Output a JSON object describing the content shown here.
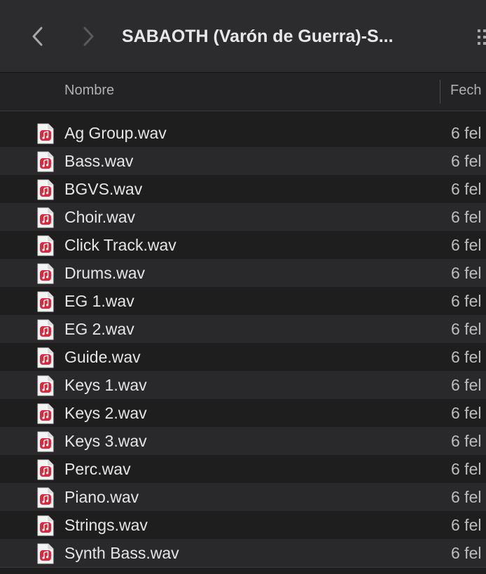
{
  "window": {
    "title": "SABAOTH (Varón de Guerra)-S..."
  },
  "toolbar": {
    "back_icon": "chevron-left-icon",
    "forward_icon": "chevron-right-icon",
    "view_icon": "grid-view-icon"
  },
  "columns": {
    "name": "Nombre",
    "date": "Fech"
  },
  "files": [
    {
      "name": "Ag Group.wav",
      "date": "6 fel"
    },
    {
      "name": "Bass.wav",
      "date": "6 fel"
    },
    {
      "name": "BGVS.wav",
      "date": "6 fel"
    },
    {
      "name": "Choir.wav",
      "date": "6 fel"
    },
    {
      "name": "Click Track.wav",
      "date": "6 fel"
    },
    {
      "name": "Drums.wav",
      "date": "6 fel"
    },
    {
      "name": "EG 1.wav",
      "date": "6 fel"
    },
    {
      "name": "EG 2.wav",
      "date": "6 fel"
    },
    {
      "name": "Guide.wav",
      "date": "6 fel"
    },
    {
      "name": "Keys 1.wav",
      "date": "6 fel"
    },
    {
      "name": "Keys 2.wav",
      "date": "6 fel"
    },
    {
      "name": "Keys 3.wav",
      "date": "6 fel"
    },
    {
      "name": "Perc.wav",
      "date": "6 fel"
    },
    {
      "name": "Piano.wav",
      "date": "6 fel"
    },
    {
      "name": "Strings.wav",
      "date": "6 fel"
    },
    {
      "name": "Synth Bass.wav",
      "date": "6 fel"
    }
  ],
  "colors": {
    "icon_accent": "#e0263a",
    "row_alt": "#29292b",
    "background": "#1e1e1e"
  },
  "icons": {
    "file": "audio-file-icon"
  }
}
